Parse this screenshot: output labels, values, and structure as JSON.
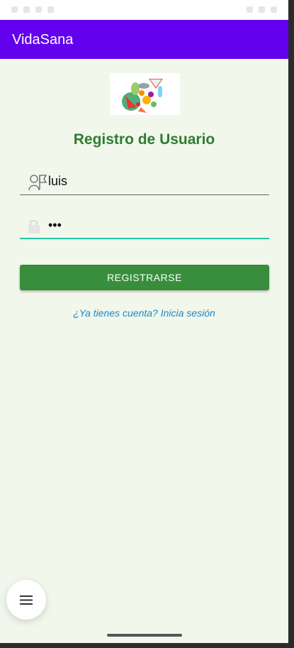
{
  "app": {
    "title": "VidaSana",
    "accent": "#6200ee"
  },
  "header": {
    "title": "Registro de Usuario",
    "color": "#2e7d32"
  },
  "logo": {
    "name": "fruits-vegetables-logo"
  },
  "form": {
    "username": {
      "value": "luis",
      "icon": "user-icon"
    },
    "password": {
      "value": "•••",
      "icon": "lock-icon"
    },
    "submit_label": "REGISTRARSE",
    "submit_color": "#388e3c",
    "login_link": "¿Ya tienes cuenta? Inicia sesión"
  },
  "fab": {
    "icon": "menu-icon"
  }
}
